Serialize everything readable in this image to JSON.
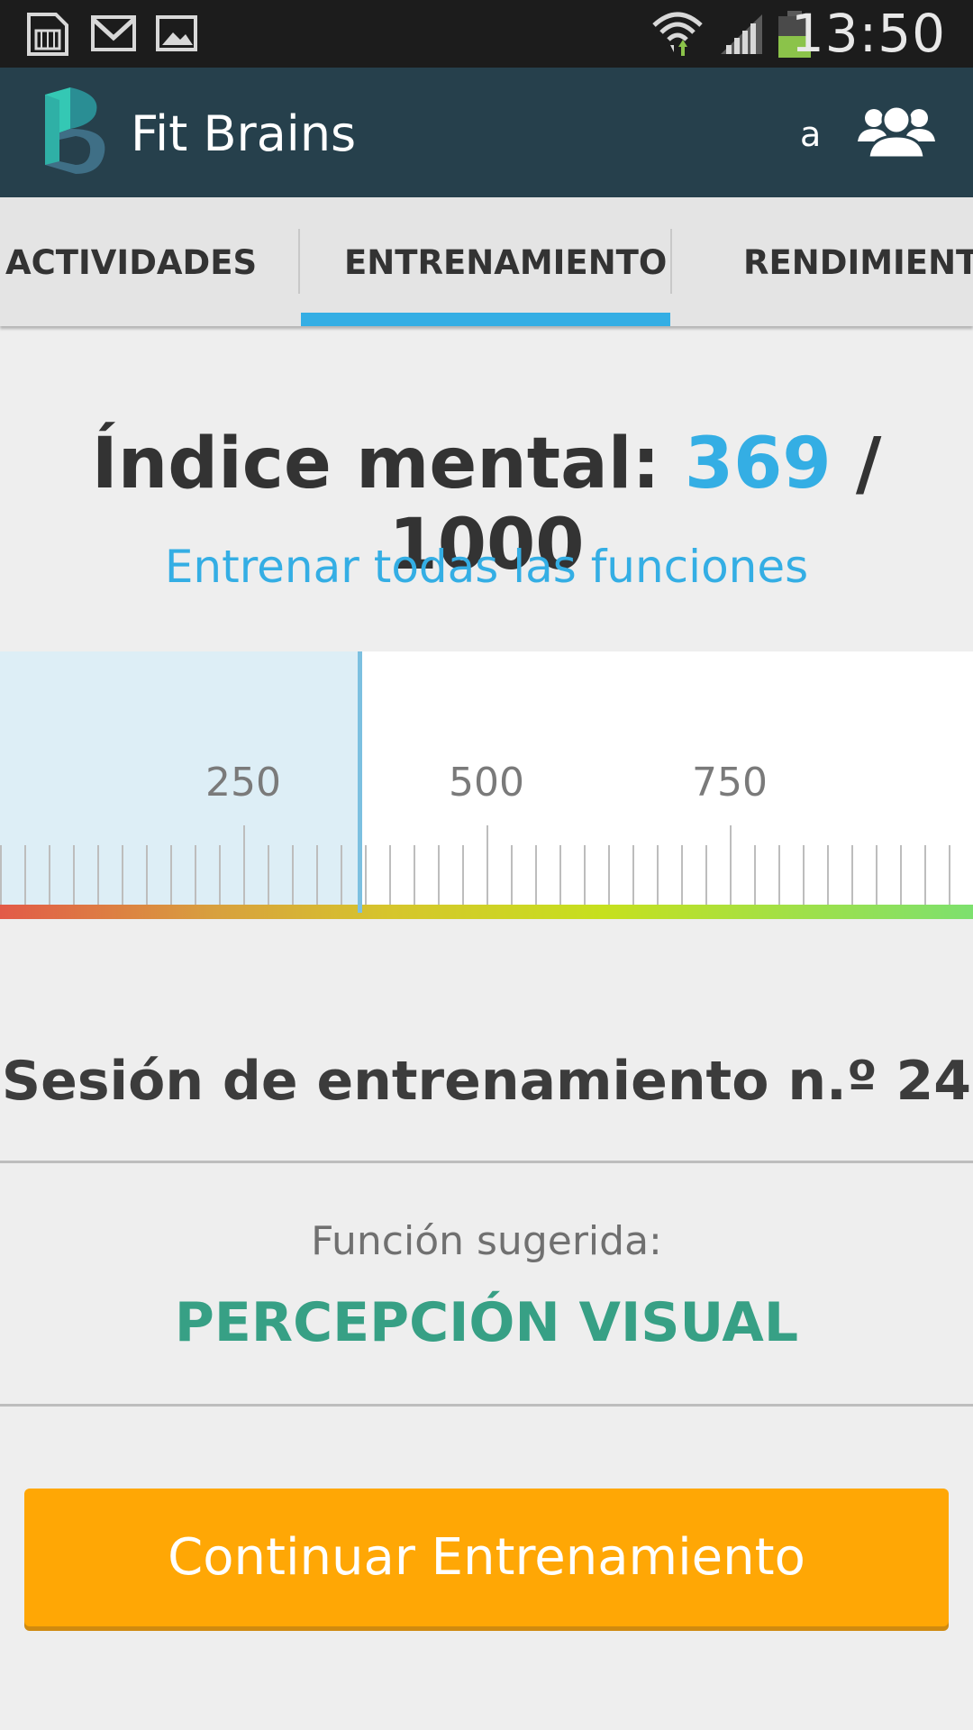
{
  "status_bar": {
    "time": "13:50",
    "icons": [
      "sd-card-icon",
      "gmail-icon",
      "image-icon",
      "wifi-icon",
      "signal-icon",
      "battery-icon"
    ],
    "battery_color": "#8bc34a"
  },
  "app_bar": {
    "title": "Fit Brains",
    "user_initial": "a",
    "logo_color": "#34c8b4",
    "icons": [
      "fit-brains-logo-icon",
      "friends-icon"
    ]
  },
  "tabs": [
    {
      "label": "ACTIVIDADES",
      "selected": false
    },
    {
      "label": "ENTRENAMIENTO",
      "selected": true
    },
    {
      "label": "RENDIMIENTO",
      "selected": false
    }
  ],
  "index": {
    "label": "Índice mental:",
    "value": "369",
    "separator": "/",
    "max": "1000",
    "link": "Entrenar todas las funciones"
  },
  "gauge": {
    "value": 369,
    "min": 0,
    "max": 1000,
    "labels": [
      "250",
      "500",
      "750"
    ]
  },
  "session": {
    "title": "Sesión de entrenamiento n.º 24"
  },
  "suggestion": {
    "label": "Función sugerida:",
    "function": "PERCEPCIÓN VISUAL"
  },
  "button": {
    "label": "Continuar Entrenamiento"
  },
  "colors": {
    "accent_blue": "#34aee4",
    "app_bar": "#26404c",
    "suggestion_green": "#37a085",
    "button_orange": "#ffa705"
  }
}
